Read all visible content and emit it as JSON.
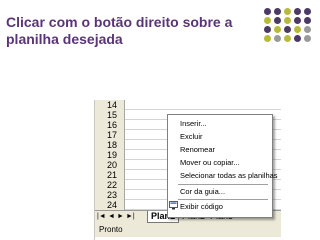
{
  "slide": {
    "title_line1": "Clicar com o botão direito sobre a",
    "title_line2": "planilha desejada"
  },
  "colors": {
    "title": "#5a3576",
    "dot_purple": "#4b3a63",
    "dot_olive": "#b7ba3a",
    "dot_gray": "#9a9a9a"
  },
  "sheet": {
    "row_numbers": [
      "14",
      "15",
      "16",
      "17",
      "18",
      "19",
      "20",
      "21",
      "22",
      "23",
      "24"
    ],
    "nav_buttons": [
      "|◄",
      "◄",
      "►",
      "►|"
    ],
    "tabs": [
      "Plan1",
      "Plan2",
      "Plan3"
    ],
    "status": "Pronto"
  },
  "context_menu": {
    "items": [
      "Inserir...",
      "Excluir",
      "Renomear",
      "Mover ou copiar...",
      "Selecionar todas as planilhas",
      "Cor da guia...",
      "Exibir código"
    ],
    "icons": [
      "view-code-icon"
    ]
  }
}
